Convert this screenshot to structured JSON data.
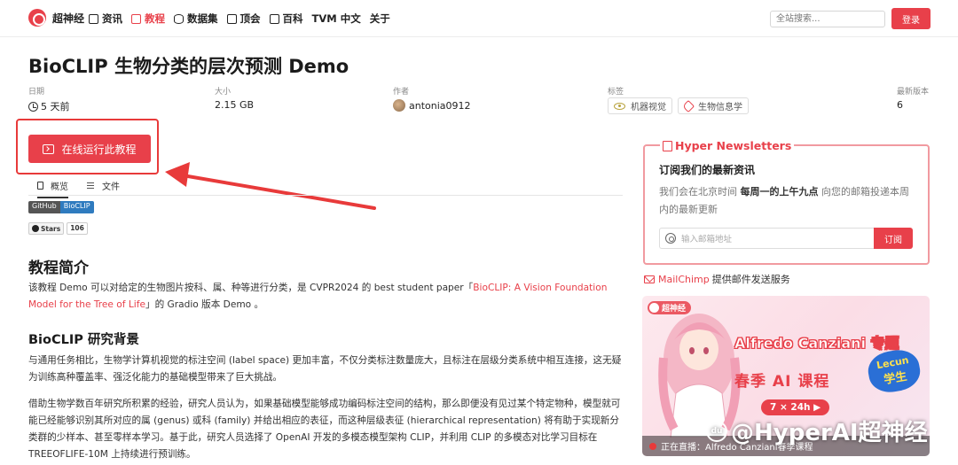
{
  "nav": {
    "logo": "超神经",
    "items": [
      {
        "label": "资讯",
        "icon": "news-icon",
        "active": false
      },
      {
        "label": "教程",
        "icon": "book-icon",
        "active": true
      },
      {
        "label": "数据集",
        "icon": "database-icon",
        "active": false
      },
      {
        "label": "顶会",
        "icon": "calendar-icon",
        "active": false
      },
      {
        "label": "百科",
        "icon": "encyclopedia-icon",
        "active": false
      },
      {
        "label": "TVM 中文",
        "icon": "",
        "active": false
      },
      {
        "label": "关于",
        "icon": "",
        "active": false
      }
    ],
    "search_placeholder": "全站搜索...",
    "login": "登录"
  },
  "page": {
    "title": "BioCLIP 生物分类的层次预测 Demo"
  },
  "meta": {
    "date_label": "日期",
    "date_value": "5 天前",
    "size_label": "大小",
    "size_value": "2.15 GB",
    "author_label": "作者",
    "author_value": "antonia0912",
    "tags_label": "标签",
    "tags": [
      "机器视觉",
      "生物信息学"
    ],
    "version_label": "最新版本",
    "version_value": "6"
  },
  "run_button": "在线运行此教程",
  "tabs": [
    "概览",
    "文件"
  ],
  "badges": {
    "github_left": "GitHub",
    "github_right": "BioCLIP",
    "stars_left": "Stars",
    "stars_count": "106"
  },
  "content": {
    "h2": "教程简介",
    "intro_pre": "该教程 Demo 可以对给定的生物图片按科、属、种等进行分类，是 CVPR2024 的 best student paper「",
    "intro_link": "BioCLIP: A Vision Foundation Model for the Tree of Life",
    "intro_post": "」的 Gradio 版本 Demo 。",
    "h3": "BioCLIP 研究背景",
    "p1": "与通用任务相比，生物学计算机视觉的标注空间 (label space) 更加丰富，不仅分类标注数量庞大，且标注在层级分类系统中相互连接，这无疑为训练高种覆盖率、强泛化能力的基础模型带来了巨大挑战。",
    "p2": "借助生物学数百年研究所积累的经验，研究人员认为，如果基础模型能够成功编码标注空间的结构，那么即便没有见过某个特定物种，模型就可能已经能够识别其所对应的属 (genus) 或科 (family) 并给出相应的表征，而这种层级表征 (hierarchical representation) 将有助于实现新分类群的少样本、甚至零样本学习。基于此，研究人员选择了 OpenAI 开发的多模态模型架构 CLIP，并利用 CLIP 的多模态对比学习目标在 TREEOFLIFE-10M 上持续进行预训练。"
  },
  "newsletter": {
    "title": "Hyper Newsletters",
    "subtitle": "订阅我们的最新资讯",
    "desc_pre": "我们会在北京时间 ",
    "desc_bold": "每周一的上午九点",
    "desc_post": " 向您的邮箱投递本周内的最新更新",
    "email_placeholder": "输入邮箱地址",
    "subscribe": "订阅",
    "mailchimp_link": "MailChimp",
    "mailchimp_text": "提供邮件发送服务"
  },
  "promo": {
    "logo": "超神经",
    "name": "Alfredo Canziani 专题",
    "course": "春季 AI 课程",
    "lecun_a": "Lecun",
    "lecun_b": "学生",
    "time": "7 × 24h ▶",
    "live": "正在直播：Alfredo Canziani春季课程"
  },
  "watermark": "@HyperAI超神经",
  "colors": {
    "accent": "#e8404a",
    "annotation_red": "#e83a3a"
  }
}
